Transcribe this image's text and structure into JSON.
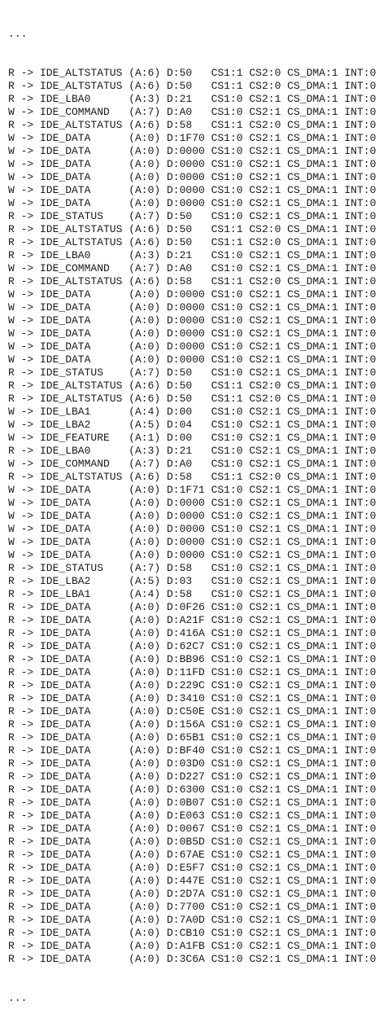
{
  "log": {
    "ellipsis_top": "...",
    "ellipsis_bottom": "...",
    "arrow": "->",
    "rows": [
      [
        "R",
        "IDE_ALTSTATUS",
        "(A:6)",
        "D:50",
        "CS1:1",
        "CS2:0",
        "CS_DMA:1",
        "INT:0"
      ],
      [
        "R",
        "IDE_ALTSTATUS",
        "(A:6)",
        "D:50",
        "CS1:1",
        "CS2:0",
        "CS_DMA:1",
        "INT:0"
      ],
      [
        "R",
        "IDE_LBA0",
        "(A:3)",
        "D:21",
        "CS1:0",
        "CS2:1",
        "CS_DMA:1",
        "INT:0"
      ],
      [
        "W",
        "IDE_COMMAND",
        "(A:7)",
        "D:A0",
        "CS1:0",
        "CS2:1",
        "CS_DMA:1",
        "INT:0"
      ],
      [
        "R",
        "IDE_ALTSTATUS",
        "(A:6)",
        "D:58",
        "CS1:1",
        "CS2:0",
        "CS_DMA:1",
        "INT:0"
      ],
      [
        "W",
        "IDE_DATA",
        "(A:0)",
        "D:1F70",
        "CS1:0",
        "CS2:1",
        "CS_DMA:1",
        "INT:0"
      ],
      [
        "W",
        "IDE_DATA",
        "(A:0)",
        "D:0000",
        "CS1:0",
        "CS2:1",
        "CS_DMA:1",
        "INT:0"
      ],
      [
        "W",
        "IDE_DATA",
        "(A:0)",
        "D:0000",
        "CS1:0",
        "CS2:1",
        "CS_DMA:1",
        "INT:0"
      ],
      [
        "W",
        "IDE_DATA",
        "(A:0)",
        "D:0000",
        "CS1:0",
        "CS2:1",
        "CS_DMA:1",
        "INT:0"
      ],
      [
        "W",
        "IDE_DATA",
        "(A:0)",
        "D:0000",
        "CS1:0",
        "CS2:1",
        "CS_DMA:1",
        "INT:0"
      ],
      [
        "W",
        "IDE_DATA",
        "(A:0)",
        "D:0000",
        "CS1:0",
        "CS2:1",
        "CS_DMA:1",
        "INT:0"
      ],
      [
        "R",
        "IDE_STATUS",
        "(A:7)",
        "D:50",
        "CS1:0",
        "CS2:1",
        "CS_DMA:1",
        "INT:0"
      ],
      [
        "R",
        "IDE_ALTSTATUS",
        "(A:6)",
        "D:50",
        "CS1:1",
        "CS2:0",
        "CS_DMA:1",
        "INT:0"
      ],
      [
        "R",
        "IDE_ALTSTATUS",
        "(A:6)",
        "D:50",
        "CS1:1",
        "CS2:0",
        "CS_DMA:1",
        "INT:0"
      ],
      [
        "R",
        "IDE_LBA0",
        "(A:3)",
        "D:21",
        "CS1:0",
        "CS2:1",
        "CS_DMA:1",
        "INT:0"
      ],
      [
        "W",
        "IDE_COMMAND",
        "(A:7)",
        "D:A0",
        "CS1:0",
        "CS2:1",
        "CS_DMA:1",
        "INT:0"
      ],
      [
        "R",
        "IDE_ALTSTATUS",
        "(A:6)",
        "D:58",
        "CS1:1",
        "CS2:0",
        "CS_DMA:1",
        "INT:0"
      ],
      [
        "W",
        "IDE_DATA",
        "(A:0)",
        "D:0000",
        "CS1:0",
        "CS2:1",
        "CS_DMA:1",
        "INT:0"
      ],
      [
        "W",
        "IDE_DATA",
        "(A:0)",
        "D:0000",
        "CS1:0",
        "CS2:1",
        "CS_DMA:1",
        "INT:0"
      ],
      [
        "W",
        "IDE_DATA",
        "(A:0)",
        "D:0000",
        "CS1:0",
        "CS2:1",
        "CS_DMA:1",
        "INT:0"
      ],
      [
        "W",
        "IDE_DATA",
        "(A:0)",
        "D:0000",
        "CS1:0",
        "CS2:1",
        "CS_DMA:1",
        "INT:0"
      ],
      [
        "W",
        "IDE_DATA",
        "(A:0)",
        "D:0000",
        "CS1:0",
        "CS2:1",
        "CS_DMA:1",
        "INT:0"
      ],
      [
        "W",
        "IDE_DATA",
        "(A:0)",
        "D:0000",
        "CS1:0",
        "CS2:1",
        "CS_DMA:1",
        "INT:0"
      ],
      [
        "R",
        "IDE_STATUS",
        "(A:7)",
        "D:50",
        "CS1:0",
        "CS2:1",
        "CS_DMA:1",
        "INT:0"
      ],
      [
        "R",
        "IDE_ALTSTATUS",
        "(A:6)",
        "D:50",
        "CS1:1",
        "CS2:0",
        "CS_DMA:1",
        "INT:0"
      ],
      [
        "R",
        "IDE_ALTSTATUS",
        "(A:6)",
        "D:50",
        "CS1:1",
        "CS2:0",
        "CS_DMA:1",
        "INT:0"
      ],
      [
        "W",
        "IDE_LBA1",
        "(A:4)",
        "D:00",
        "CS1:0",
        "CS2:1",
        "CS_DMA:1",
        "INT:0"
      ],
      [
        "W",
        "IDE_LBA2",
        "(A:5)",
        "D:04",
        "CS1:0",
        "CS2:1",
        "CS_DMA:1",
        "INT:0"
      ],
      [
        "W",
        "IDE_FEATURE",
        "(A:1)",
        "D:00",
        "CS1:0",
        "CS2:1",
        "CS_DMA:1",
        "INT:0"
      ],
      [
        "R",
        "IDE_LBA0",
        "(A:3)",
        "D:21",
        "CS1:0",
        "CS2:1",
        "CS_DMA:1",
        "INT:0"
      ],
      [
        "W",
        "IDE_COMMAND",
        "(A:7)",
        "D:A0",
        "CS1:0",
        "CS2:1",
        "CS_DMA:1",
        "INT:0"
      ],
      [
        "R",
        "IDE_ALTSTATUS",
        "(A:6)",
        "D:58",
        "CS1:1",
        "CS2:0",
        "CS_DMA:1",
        "INT:0"
      ],
      [
        "W",
        "IDE_DATA",
        "(A:0)",
        "D:1F71",
        "CS1:0",
        "CS2:1",
        "CS_DMA:1",
        "INT:0"
      ],
      [
        "W",
        "IDE_DATA",
        "(A:0)",
        "D:0000",
        "CS1:0",
        "CS2:1",
        "CS_DMA:1",
        "INT:0"
      ],
      [
        "W",
        "IDE_DATA",
        "(A:0)",
        "D:0000",
        "CS1:0",
        "CS2:1",
        "CS_DMA:1",
        "INT:0"
      ],
      [
        "W",
        "IDE_DATA",
        "(A:0)",
        "D:0000",
        "CS1:0",
        "CS2:1",
        "CS_DMA:1",
        "INT:0"
      ],
      [
        "W",
        "IDE_DATA",
        "(A:0)",
        "D:0000",
        "CS1:0",
        "CS2:1",
        "CS_DMA:1",
        "INT:0"
      ],
      [
        "W",
        "IDE_DATA",
        "(A:0)",
        "D:0000",
        "CS1:0",
        "CS2:1",
        "CS_DMA:1",
        "INT:0"
      ],
      [
        "R",
        "IDE_STATUS",
        "(A:7)",
        "D:58",
        "CS1:0",
        "CS2:1",
        "CS_DMA:1",
        "INT:0"
      ],
      [
        "R",
        "IDE_LBA2",
        "(A:5)",
        "D:03",
        "CS1:0",
        "CS2:1",
        "CS_DMA:1",
        "INT:0"
      ],
      [
        "R",
        "IDE_LBA1",
        "(A:4)",
        "D:58",
        "CS1:0",
        "CS2:1",
        "CS_DMA:1",
        "INT:0"
      ],
      [
        "R",
        "IDE_DATA",
        "(A:0)",
        "D:0F26",
        "CS1:0",
        "CS2:1",
        "CS_DMA:1",
        "INT:0"
      ],
      [
        "R",
        "IDE_DATA",
        "(A:0)",
        "D:A21F",
        "CS1:0",
        "CS2:1",
        "CS_DMA:1",
        "INT:0"
      ],
      [
        "R",
        "IDE_DATA",
        "(A:0)",
        "D:416A",
        "CS1:0",
        "CS2:1",
        "CS_DMA:1",
        "INT:0"
      ],
      [
        "R",
        "IDE_DATA",
        "(A:0)",
        "D:62C7",
        "CS1:0",
        "CS2:1",
        "CS_DMA:1",
        "INT:0"
      ],
      [
        "R",
        "IDE_DATA",
        "(A:0)",
        "D:BB96",
        "CS1:0",
        "CS2:1",
        "CS_DMA:1",
        "INT:0"
      ],
      [
        "R",
        "IDE_DATA",
        "(A:0)",
        "D:11FD",
        "CS1:0",
        "CS2:1",
        "CS_DMA:1",
        "INT:0"
      ],
      [
        "R",
        "IDE_DATA",
        "(A:0)",
        "D:229C",
        "CS1:0",
        "CS2:1",
        "CS_DMA:1",
        "INT:0"
      ],
      [
        "R",
        "IDE_DATA",
        "(A:0)",
        "D:3410",
        "CS1:0",
        "CS2:1",
        "CS_DMA:1",
        "INT:0"
      ],
      [
        "R",
        "IDE_DATA",
        "(A:0)",
        "D:C50E",
        "CS1:0",
        "CS2:1",
        "CS_DMA:1",
        "INT:0"
      ],
      [
        "R",
        "IDE_DATA",
        "(A:0)",
        "D:156A",
        "CS1:0",
        "CS2:1",
        "CS_DMA:1",
        "INT:0"
      ],
      [
        "R",
        "IDE_DATA",
        "(A:0)",
        "D:65B1",
        "CS1:0",
        "CS2:1",
        "CS_DMA:1",
        "INT:0"
      ],
      [
        "R",
        "IDE_DATA",
        "(A:0)",
        "D:BF40",
        "CS1:0",
        "CS2:1",
        "CS_DMA:1",
        "INT:0"
      ],
      [
        "R",
        "IDE_DATA",
        "(A:0)",
        "D:03D0",
        "CS1:0",
        "CS2:1",
        "CS_DMA:1",
        "INT:0"
      ],
      [
        "R",
        "IDE_DATA",
        "(A:0)",
        "D:D227",
        "CS1:0",
        "CS2:1",
        "CS_DMA:1",
        "INT:0"
      ],
      [
        "R",
        "IDE_DATA",
        "(A:0)",
        "D:6300",
        "CS1:0",
        "CS2:1",
        "CS_DMA:1",
        "INT:0"
      ],
      [
        "R",
        "IDE_DATA",
        "(A:0)",
        "D:0B07",
        "CS1:0",
        "CS2:1",
        "CS_DMA:1",
        "INT:0"
      ],
      [
        "R",
        "IDE_DATA",
        "(A:0)",
        "D:E063",
        "CS1:0",
        "CS2:1",
        "CS_DMA:1",
        "INT:0"
      ],
      [
        "R",
        "IDE_DATA",
        "(A:0)",
        "D:0067",
        "CS1:0",
        "CS2:1",
        "CS_DMA:1",
        "INT:0"
      ],
      [
        "R",
        "IDE_DATA",
        "(A:0)",
        "D:0B5D",
        "CS1:0",
        "CS2:1",
        "CS_DMA:1",
        "INT:0"
      ],
      [
        "R",
        "IDE_DATA",
        "(A:0)",
        "D:67AE",
        "CS1:0",
        "CS2:1",
        "CS_DMA:1",
        "INT:0"
      ],
      [
        "R",
        "IDE_DATA",
        "(A:0)",
        "D:E5F7",
        "CS1:0",
        "CS2:1",
        "CS_DMA:1",
        "INT:0"
      ],
      [
        "R",
        "IDE_DATA",
        "(A:0)",
        "D:447E",
        "CS1:0",
        "CS2:1",
        "CS_DMA:1",
        "INT:0"
      ],
      [
        "R",
        "IDE_DATA",
        "(A:0)",
        "D:2D7A",
        "CS1:0",
        "CS2:1",
        "CS_DMA:1",
        "INT:0"
      ],
      [
        "R",
        "IDE_DATA",
        "(A:0)",
        "D:7700",
        "CS1:0",
        "CS2:1",
        "CS_DMA:1",
        "INT:0"
      ],
      [
        "R",
        "IDE_DATA",
        "(A:0)",
        "D:7A0D",
        "CS1:0",
        "CS2:1",
        "CS_DMA:1",
        "INT:0"
      ],
      [
        "R",
        "IDE_DATA",
        "(A:0)",
        "D:CB10",
        "CS1:0",
        "CS2:1",
        "CS_DMA:1",
        "INT:0"
      ],
      [
        "R",
        "IDE_DATA",
        "(A:0)",
        "D:A1FB",
        "CS1:0",
        "CS2:1",
        "CS_DMA:1",
        "INT:0"
      ],
      [
        "R",
        "IDE_DATA",
        "(A:0)",
        "D:3C6A",
        "CS1:0",
        "CS2:1",
        "CS_DMA:1",
        "INT:0"
      ]
    ]
  }
}
